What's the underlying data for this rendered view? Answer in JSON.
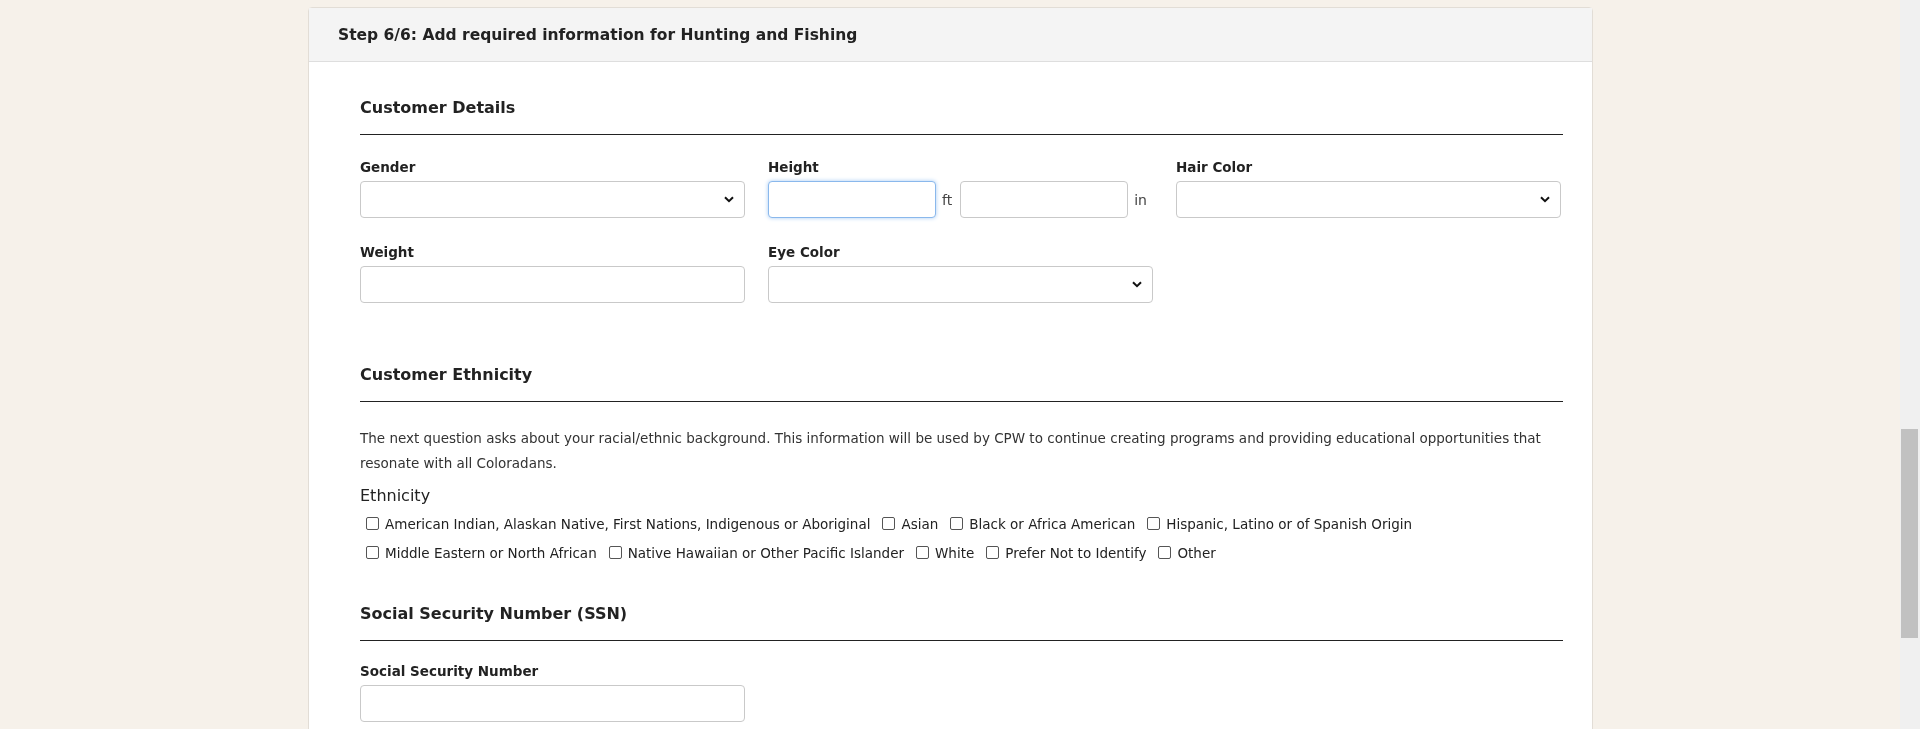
{
  "card": {
    "title": "Step 6/6: Add required information for Hunting and Fishing"
  },
  "customer_details": {
    "heading": "Customer Details",
    "fields": [
      {
        "kind": "select",
        "label": "Gender",
        "focused": false
      },
      {
        "kind": "height",
        "label": "Height",
        "focused": true,
        "feet_unit": "ft",
        "inches_unit": "in"
      },
      {
        "kind": "select",
        "label": "Hair Color",
        "focused": false
      },
      {
        "kind": "text",
        "label": "Weight",
        "focused": false
      },
      {
        "kind": "select",
        "label": "Eye Color",
        "focused": false
      }
    ]
  },
  "customer_ethnicity": {
    "heading": "Customer Ethnicity",
    "description": "The next question asks about your racial/ethnic background. This information will be used by CPW to continue creating programs and providing educational opportunities that resonate with all Coloradans.",
    "label": "Ethnicity",
    "options": [
      {
        "label": "American Indian, Alaskan Native, First Nations, Indigenous or Aboriginal",
        "checked": false
      },
      {
        "label": "Asian",
        "checked": false
      },
      {
        "label": "Black or Africa American",
        "checked": false
      },
      {
        "label": "Hispanic, Latino or of Spanish Origin",
        "checked": false
      },
      {
        "label": "Middle Eastern or North African",
        "checked": false
      },
      {
        "label": "Native Hawaiian or Other Pacific Islander",
        "checked": false
      },
      {
        "label": "White",
        "checked": false
      },
      {
        "label": "Prefer Not to Identify",
        "checked": false
      },
      {
        "label": "Other",
        "checked": false
      }
    ]
  },
  "ssn": {
    "heading": "Social Security Number (SSN)",
    "fields": [
      {
        "kind": "text",
        "label": "Social Security Number",
        "focused": false
      }
    ]
  }
}
